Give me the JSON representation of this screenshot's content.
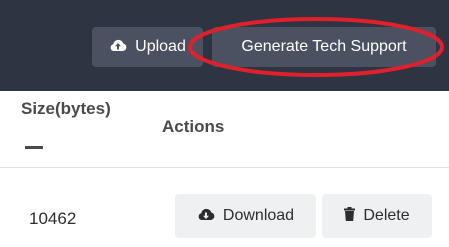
{
  "toolbar": {
    "upload_label": "Upload",
    "upload_icon": "cloud-upload-icon",
    "generate_label": "Generate Tech Support"
  },
  "table": {
    "headers": [
      "Size(bytes)",
      "Actions"
    ],
    "rows": [
      {
        "size": "10462",
        "download_label": "Download",
        "download_icon": "cloud-download-icon",
        "delete_label": "Delete",
        "delete_icon": "trash-icon"
      }
    ]
  },
  "colors": {
    "topbar_bg": "#2e3542",
    "button_dark": "#4b5160",
    "button_light": "#eef0f2",
    "highlight_circle": "#e0202a"
  }
}
